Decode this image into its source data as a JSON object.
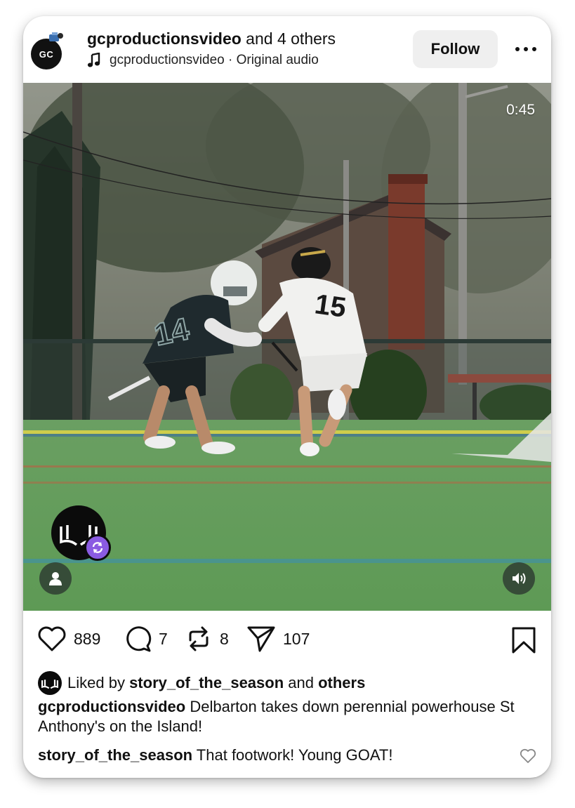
{
  "header": {
    "author_name": "gcproductionsvideo",
    "author_suffix": " and 4 others",
    "avatar_text": "GC",
    "audio_label": "gcproductionsvideo · Original audio",
    "follow_label": "Follow",
    "more_icon": "more-horizontal-icon"
  },
  "media": {
    "duration": "0:45",
    "collab_badge_icon": "collab-refresh-icon",
    "tagged_icon": "person-icon",
    "sound_icon": "volume-icon",
    "jersey_numbers": [
      "14",
      "15"
    ]
  },
  "actions": {
    "likes": "889",
    "comments": "7",
    "reposts": "8",
    "shares": "107"
  },
  "liked_by": {
    "prefix": "Liked by ",
    "user": "story_of_the_season",
    "middle": " and ",
    "others": "others"
  },
  "caption": {
    "user": "gcproductionsvideo",
    "text": " Delbarton takes down perennial powerhouse St Anthony's on the Island!"
  },
  "comment": {
    "user": "story_of_the_season",
    "text": " That footwork! Young GOAT!"
  },
  "colors": {
    "accent_purple": "#8a5be2",
    "follow_bg": "#efefef",
    "turf_green": "#5e9a55"
  }
}
